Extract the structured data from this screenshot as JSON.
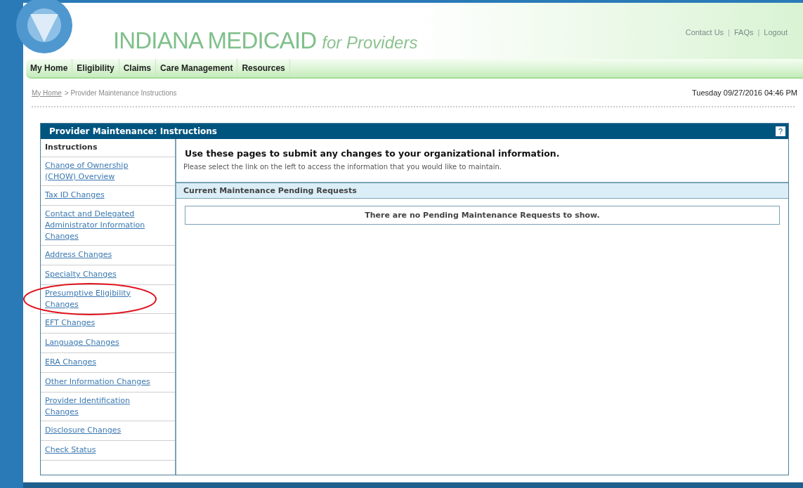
{
  "header": {
    "title": "INDIANA MEDICAID",
    "subtitle": "for Providers",
    "links": [
      "Contact Us",
      "FAQs",
      "Logout"
    ],
    "link_separator": "|"
  },
  "nav": [
    "My Home",
    "Eligibility",
    "Claims",
    "Care Management",
    "Resources"
  ],
  "breadcrumb": {
    "link": "My Home",
    "current": "> Provider Maintenance Instructions"
  },
  "datetime": "Tuesday 09/27/2016 04:46 PM",
  "panel": {
    "title": "Provider Maintenance: Instructions",
    "help": "?",
    "sidebar": {
      "heading": "Instructions",
      "items": [
        {
          "label": "Change of Ownership (CHOW) Overview",
          "circled": false
        },
        {
          "label": "Tax ID Changes",
          "circled": false
        },
        {
          "label": "Contact and Delegated Administrator Information Changes",
          "circled": false
        },
        {
          "label": "Address Changes",
          "circled": false
        },
        {
          "label": "Specialty Changes",
          "circled": false
        },
        {
          "label": "Presumptive Eligibility Changes",
          "circled": true
        },
        {
          "label": "EFT Changes",
          "circled": false
        },
        {
          "label": "Language Changes",
          "circled": false
        },
        {
          "label": "ERA Changes",
          "circled": false
        },
        {
          "label": "Other Information Changes",
          "circled": false
        },
        {
          "label": "Provider Identification Changes",
          "circled": false
        },
        {
          "label": "Disclosure Changes",
          "circled": false
        },
        {
          "label": "Check Status",
          "circled": false
        }
      ]
    },
    "intro_heading": "Use these pages to submit any changes to your organizational information.",
    "intro_text": "Please select the link on the left to access the information that you would like to maintain.",
    "pending": {
      "heading": "Current Maintenance Pending Requests",
      "empty_message": "There are no Pending Maintenance Requests to show."
    }
  }
}
